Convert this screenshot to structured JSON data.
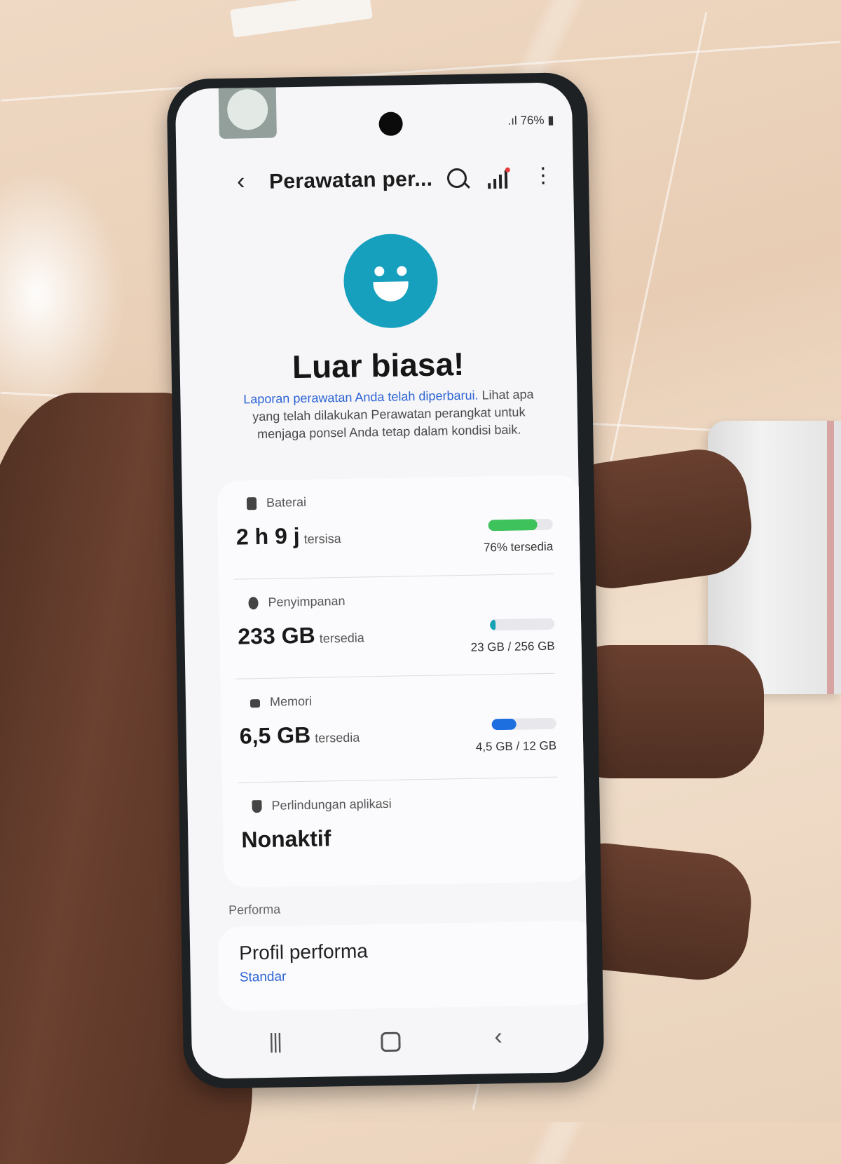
{
  "status_bar": {
    "battery": "76%"
  },
  "app_bar": {
    "title": "Perawatan per...",
    "back_icon": "chevron-left-icon",
    "search_icon": "search-icon",
    "diagnostics_icon": "signal-bars-icon",
    "more_icon": "more-vert-icon"
  },
  "summary": {
    "headline": "Luar biasa!",
    "link_text": "Laporan perawatan Anda telah diperbarui.",
    "body_text": " Lihat apa yang telah dilakukan Perawatan perangkat untuk menjaga ponsel Anda tetap dalam kondisi baik."
  },
  "items": [
    {
      "label": "Baterai",
      "value": "2 h 9 j",
      "suffix": "tersisa",
      "right": "76% tersedia",
      "fill_fraction": 0.76,
      "color": "#3ec25c"
    },
    {
      "label": "Penyimpanan",
      "value": "233 GB",
      "suffix": "tersedia",
      "right": "23 GB / 256 GB",
      "fill_fraction": 0.09,
      "color": "#18a3b5"
    },
    {
      "label": "Memori",
      "value": "6,5 GB",
      "suffix": "tersedia",
      "right": "4,5 GB / 12 GB",
      "fill_fraction": 0.38,
      "color": "#1d6fe0"
    },
    {
      "label": "Perlindungan aplikasi",
      "value": "Nonaktif"
    }
  ],
  "performance": {
    "section": "Performa",
    "profile_title": "Profil performa",
    "profile_value": "Standar"
  },
  "nav_bar": {
    "recents_icon": "recents-icon",
    "home_icon": "home-icon",
    "back_icon": "back-icon"
  }
}
